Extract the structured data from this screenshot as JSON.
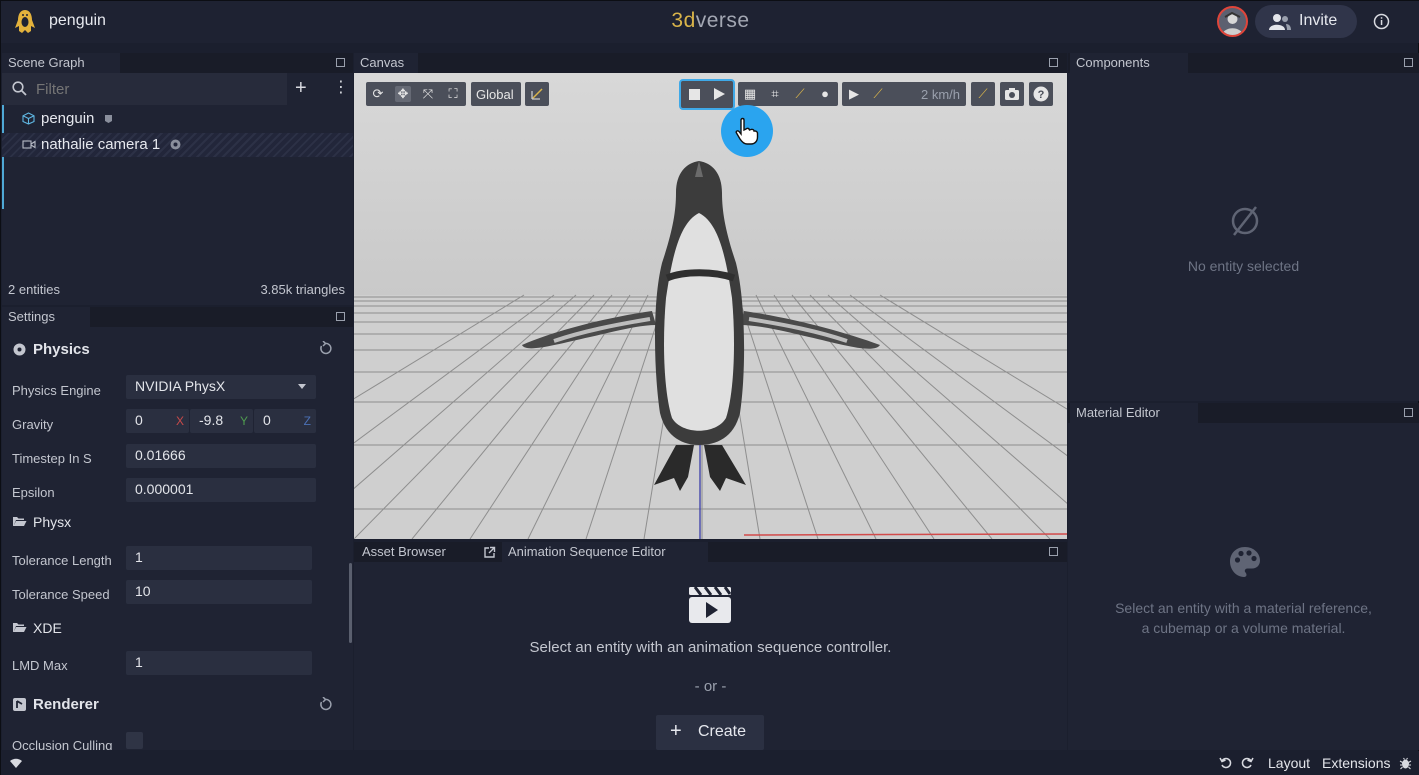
{
  "app": {
    "project_name": "penguin",
    "brand_prefix": "3d",
    "brand_suffix": "verse",
    "invite_label": "Invite"
  },
  "scene_graph": {
    "tab": "Scene Graph",
    "filter_placeholder": "Filter",
    "items": [
      {
        "label": "penguin"
      },
      {
        "label": "nathalie camera 1"
      }
    ],
    "footer_entities": "2 entities",
    "footer_triangles": "3.85k triangles"
  },
  "settings": {
    "tab": "Settings",
    "physics_title": "Physics",
    "engine_label": "Physics Engine",
    "engine_value": "NVIDIA PhysX",
    "gravity_label": "Gravity",
    "gravity": {
      "x": "0",
      "y": "-9.8",
      "z": "0",
      "x_axis": "X",
      "y_axis": "Y",
      "z_axis": "Z"
    },
    "timestep_label": "Timestep In S",
    "timestep_value": "0.01666",
    "epsilon_label": "Epsilon",
    "epsilon_value": "0.000001",
    "physx_title": "Physx",
    "tol_length_label": "Tolerance Length",
    "tol_length_value": "1",
    "tol_speed_label": "Tolerance Speed",
    "tol_speed_value": "10",
    "xde_title": "XDE",
    "lmd_label": "LMD Max",
    "lmd_value": "1",
    "renderer_title": "Renderer",
    "occlusion_label": "Occlusion Culling"
  },
  "canvas": {
    "tab": "Canvas",
    "space_label": "Global",
    "speed_label": "2 km/h"
  },
  "components": {
    "tab": "Components",
    "empty": "No entity selected"
  },
  "material_editor": {
    "tab": "Material Editor",
    "empty_line1": "Select an entity with a material reference,",
    "empty_line2": "a cubemap or a volume material."
  },
  "bottom": {
    "asset_tab": "Asset Browser",
    "anim_tab": "Animation Sequence Editor",
    "message": "Select an entity with an animation sequence controller.",
    "or": "- or -",
    "create_label": "Create"
  },
  "status": {
    "layout": "Layout",
    "extensions": "Extensions"
  }
}
